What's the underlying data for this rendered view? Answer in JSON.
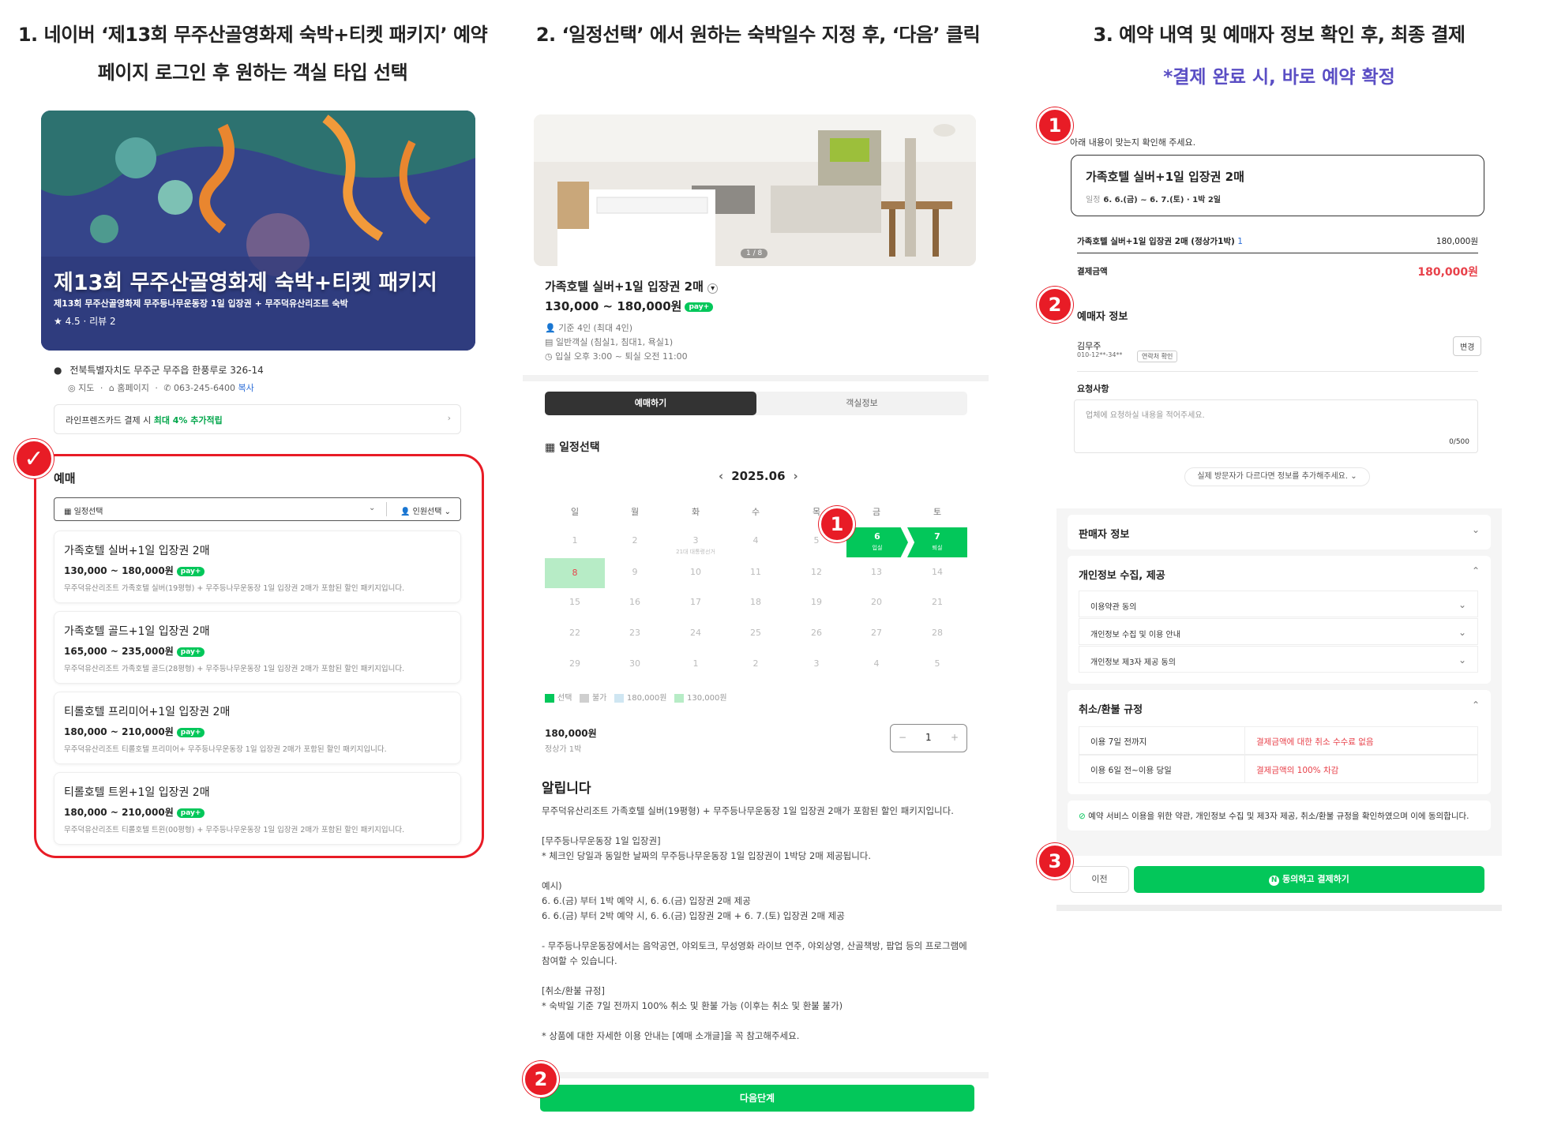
{
  "headers": {
    "step1_line1": "1. 네이버 ‘제13회 무주산골영화제 숙박+티켓 패키지’ 예약",
    "step1_line2": "페이지 로그인 후 원하는 객실 타입 선택",
    "step2": "2. ‘일정선택’ 에서 원하는 숙박일수 지정 후, ‘다음’ 클릭",
    "step3": "3. 예약 내역 및 예매자 정보 확인 후, 최종 결제",
    "step3_note": "*결제 완료 시, 바로 예약 확정"
  },
  "col1": {
    "banner_title": "제13회 무주산골영화제 숙박+티켓 패키지",
    "banner_sub": "제13회 무주산골영화제 무주등나무운동장 1일 입장권 + 무주덕유산리조트 숙박",
    "rating": "★ 4.5 · 리뷰 2",
    "address": "전북특별자치도 무주군 무주읍 한풍루로 326-14",
    "link_map": "지도",
    "link_home": "홈페이지",
    "phone": "063-245-6400",
    "copy": "복사",
    "card_text": "라인프렌즈카드 결제 시",
    "card_bold": "최대 4% 추가적립",
    "section": "예매",
    "date_select": "일정선택",
    "people_select": "인원선택",
    "pay_badge": "pay+",
    "rooms": [
      {
        "name": "가족호텔 실버+1일 입장권 2매",
        "price": "130,000 ~ 180,000원",
        "desc": "무주덕유산리조트 가족호텔 실버(19평형) + 무주등나무운동장 1일 입장권 2매가 포함된 할인 패키지입니다."
      },
      {
        "name": "가족호텔 골드+1일 입장권 2매",
        "price": "165,000 ~ 235,000원",
        "desc": "무주덕유산리조트 가족호텔 골드(28평형) + 무주등나무운동장 1일 입장권 2매가 포함된 할인 패키지입니다."
      },
      {
        "name": "티롤호텔 프리미어+1일 입장권 2매",
        "price": "180,000 ~ 210,000원",
        "desc": "무주덕유산리조트 티롤호텔 프리미어+ 무주등나무운동장 1일 입장권 2매가 포함된 할인 패키지입니다."
      },
      {
        "name": "티롤호텔 트윈+1일 입장권 2매",
        "price": "180,000 ~ 210,000원",
        "desc": "무주덕유산리조트 티롤호텔 트윈(00평형) + 무주등나무운동장 1일 입장권 2매가 포함된 할인 패키지입니다."
      }
    ]
  },
  "col2": {
    "photo_counter": "1 / 8",
    "title": "가족호텔 실버+1일 입장권 2매",
    "price": "130,000 ~ 180,000원",
    "info": [
      "기준 4인 (최대 4인)",
      "일반객실 (침실1, 침대1, 욕실1)",
      "입실 오후 3:00 ~ 퇴실 오전 11:00"
    ],
    "tab_active": "예매하기",
    "tab_inactive": "객실정보",
    "schedule": "일정선택",
    "month": "2025.06",
    "weekdays": [
      "일",
      "월",
      "화",
      "수",
      "목",
      "금",
      "토"
    ],
    "weeks": [
      [
        "1",
        "2",
        "3",
        "4",
        "5",
        "6",
        "7"
      ],
      [
        "8",
        "9",
        "10",
        "11",
        "12",
        "13",
        "14"
      ],
      [
        "15",
        "16",
        "17",
        "18",
        "19",
        "20",
        "21"
      ],
      [
        "22",
        "23",
        "24",
        "25",
        "26",
        "27",
        "28"
      ],
      [
        "29",
        "30",
        "1",
        "2",
        "3",
        "4",
        "5"
      ]
    ],
    "day3_note": "21대 대통령선거",
    "checkin": "입실",
    "checkout": "퇴실",
    "legend": [
      "선택",
      "불가",
      "180,000원",
      "130,000원"
    ],
    "total_price": "180,000원",
    "total_note": "정상가 1박",
    "qty": "1",
    "notice_title": "알립니다",
    "notice_body": "무주덕유산리조트 가족호텔 실버(19평형) + 무주등나무운동장 1일 입장권 2매가 포함된 할인 패키지입니다.\n\n[무주등나무운동장 1일 입장권]\n* 체크인 당일과 동일한 날짜의 무주등나무운동장 1일 입장권이 1박당 2매 제공됩니다.\n\n예시)\n6. 6.(금) 부터 1박 예약 시, 6. 6.(금) 입장권 2매 제공\n6. 6.(금) 부터 2박 예약 시, 6. 6.(금) 입장권 2매 + 6. 7.(토) 입장권 2매 제공\n\n- 무주등나무운동장에서는 음악공연, 야외토크, 무성영화 라이브 연주, 야외상영, 산골책방, 팝업 등의 프로그램에 참여할 수 있습니다.\n\n[취소/환불 규정]\n* 숙박일 기준 7일 전까지 100% 취소 및 환불 가능 (이후는 취소 및 환불 불가)\n\n* 상품에 대한 자세한 이용 안내는 [예매 소개글]을 꼭 참고해주세요.",
    "next_btn": "다음단계"
  },
  "col3": {
    "confirm_text": "아래 내용이 맞는지 확인해 주세요.",
    "summary_title": "가족호텔 실버+1일 입장권 2매",
    "summary_label": "일정",
    "summary_dates": "6. 6.(금) ~ 6. 7.(토) · 1박 2일",
    "line_item": "가족호텔 실버+1일 입장권 2매 (정상가1박)",
    "line_qty": "1",
    "line_price": "180,000원",
    "pay_label": "결제금액",
    "pay_amount": "180,000원",
    "booker_title": "예매자 정보",
    "booker_name": "김무주",
    "booker_phone": "010-12**-34**",
    "verify": "연락처 확인",
    "change": "변경",
    "request_title": "요청사항",
    "request_placeholder": "업체에 요청하실 내용을 적어주세요.",
    "request_count": "0/500",
    "add_visitor": "실제 방문자가 다르다면 정보를 추가해주세요.",
    "seller": "판매자 정보",
    "privacy": "개인정보 수집, 제공",
    "privacy_items": [
      "이용약관 동의",
      "개인정보 수집 및 이용 안내",
      "개인정보 제3자 제공 동의"
    ],
    "refund_title": "취소/환불 규정",
    "refund_rows": [
      {
        "k": "이용 7일 전까지",
        "v": "결제금액에 대한 취소 수수료 없음"
      },
      {
        "k": "이용 6일 전~이용 당일",
        "v": "결제금액의 100% 차감"
      }
    ],
    "agree": "예약 서비스 이용을 위한 약관, 개인정보 수집 및 제3자 제공, 취소/환불 규정을 확인하였으며 이에 동의합니다.",
    "prev_btn": "이전",
    "pay_btn": "동의하고 결제하기"
  },
  "markers": {
    "one": "1",
    "two": "2",
    "three": "3",
    "check": "✓"
  },
  "colors": {
    "brand_green": "#03c75a",
    "marker_red": "#e81c26",
    "note_purple": "#5a4ec4"
  }
}
